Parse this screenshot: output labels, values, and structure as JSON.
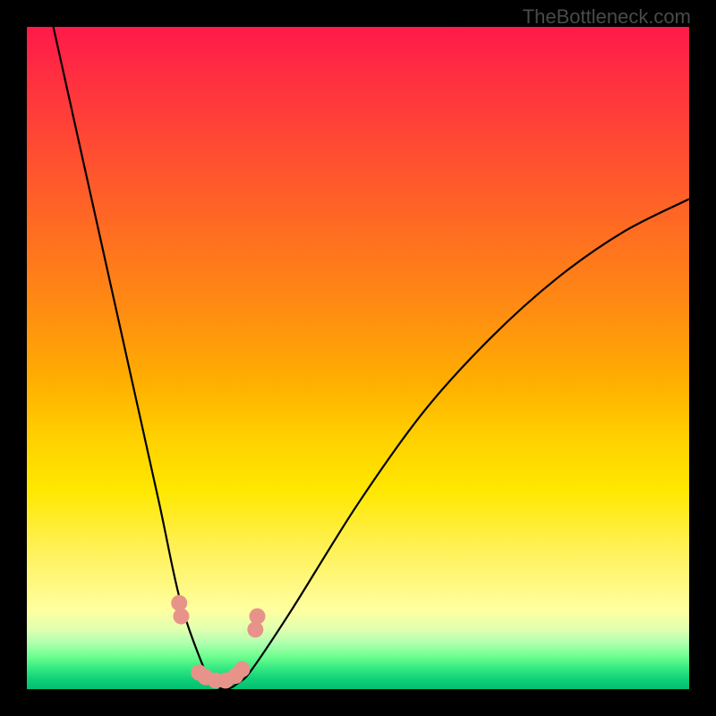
{
  "watermark": "TheBottleneck.com",
  "chart_data": {
    "type": "line",
    "title": "",
    "xlabel": "",
    "ylabel": "",
    "xlim": [
      0,
      100
    ],
    "ylim": [
      0,
      100
    ],
    "series": [
      {
        "name": "bottleneck-curve",
        "x": [
          4,
          8,
          12,
          16,
          20,
          23,
          26,
          28,
          30,
          32,
          34,
          40,
          50,
          60,
          70,
          80,
          90,
          100
        ],
        "y": [
          100,
          82,
          64,
          46,
          28,
          14,
          5,
          1,
          0,
          1,
          3,
          12,
          28,
          42,
          53,
          62,
          69,
          74
        ]
      }
    ],
    "markers": {
      "name": "highlight-points",
      "color": "#e8938a",
      "points": [
        {
          "x": 23.0,
          "y": 13
        },
        {
          "x": 23.3,
          "y": 11
        },
        {
          "x": 26.0,
          "y": 2.5
        },
        {
          "x": 27.0,
          "y": 1.8
        },
        {
          "x": 28.5,
          "y": 1.3
        },
        {
          "x": 30.0,
          "y": 1.3
        },
        {
          "x": 31.5,
          "y": 2.0
        },
        {
          "x": 32.5,
          "y": 3.0
        },
        {
          "x": 34.5,
          "y": 9
        },
        {
          "x": 34.8,
          "y": 11
        }
      ]
    },
    "background": {
      "type": "vertical-gradient",
      "stops": [
        {
          "pos": 0,
          "color": "#ff1a4a"
        },
        {
          "pos": 50,
          "color": "#ffd000"
        },
        {
          "pos": 88,
          "color": "#ffffa0"
        },
        {
          "pos": 100,
          "color": "#00c070"
        }
      ]
    }
  }
}
